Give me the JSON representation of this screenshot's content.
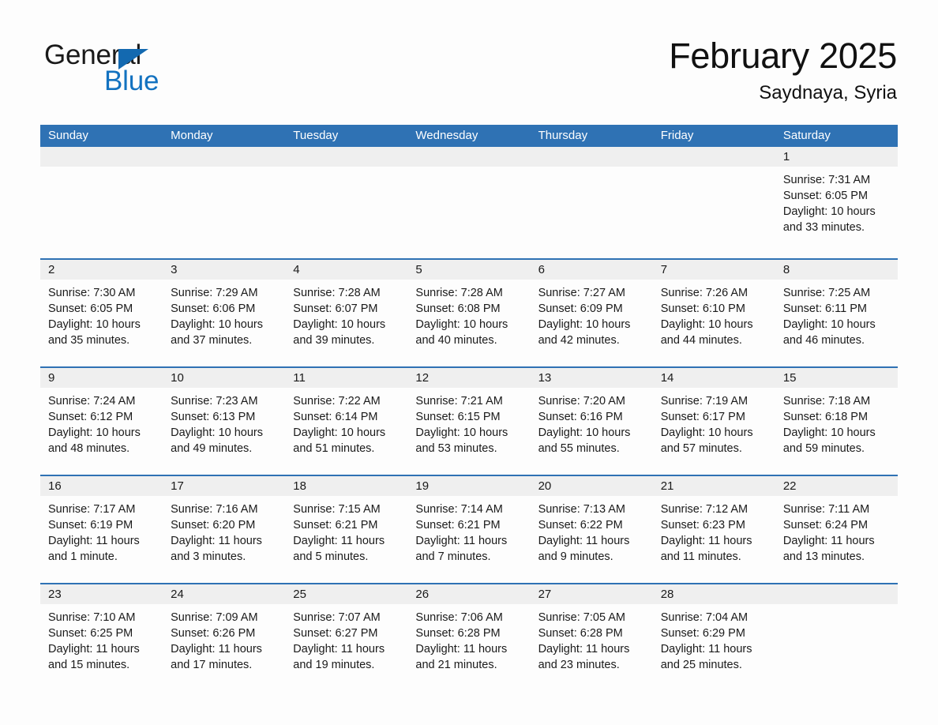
{
  "brand": {
    "name_part1": "General",
    "name_part2": "Blue",
    "logo_icon": "triangle-icon",
    "color_primary": "#1372c0",
    "color_dark": "#1a1a1a"
  },
  "header": {
    "title": "February 2025",
    "location": "Saydnaya, Syria"
  },
  "theme": {
    "header_blue": "#2f72b4",
    "date_band_gray": "#efefef",
    "page_background": "#fdfdfd",
    "text": "#1a1a1a"
  },
  "weekdays": [
    "Sunday",
    "Monday",
    "Tuesday",
    "Wednesday",
    "Thursday",
    "Friday",
    "Saturday"
  ],
  "weeks": [
    [
      {
        "date": "",
        "empty": true
      },
      {
        "date": "",
        "empty": true
      },
      {
        "date": "",
        "empty": true
      },
      {
        "date": "",
        "empty": true
      },
      {
        "date": "",
        "empty": true
      },
      {
        "date": "",
        "empty": true
      },
      {
        "date": "1",
        "sunrise": "Sunrise: 7:31 AM",
        "sunset": "Sunset: 6:05 PM",
        "daylight": "Daylight: 10 hours and 33 minutes."
      }
    ],
    [
      {
        "date": "2",
        "sunrise": "Sunrise: 7:30 AM",
        "sunset": "Sunset: 6:05 PM",
        "daylight": "Daylight: 10 hours and 35 minutes."
      },
      {
        "date": "3",
        "sunrise": "Sunrise: 7:29 AM",
        "sunset": "Sunset: 6:06 PM",
        "daylight": "Daylight: 10 hours and 37 minutes."
      },
      {
        "date": "4",
        "sunrise": "Sunrise: 7:28 AM",
        "sunset": "Sunset: 6:07 PM",
        "daylight": "Daylight: 10 hours and 39 minutes."
      },
      {
        "date": "5",
        "sunrise": "Sunrise: 7:28 AM",
        "sunset": "Sunset: 6:08 PM",
        "daylight": "Daylight: 10 hours and 40 minutes."
      },
      {
        "date": "6",
        "sunrise": "Sunrise: 7:27 AM",
        "sunset": "Sunset: 6:09 PM",
        "daylight": "Daylight: 10 hours and 42 minutes."
      },
      {
        "date": "7",
        "sunrise": "Sunrise: 7:26 AM",
        "sunset": "Sunset: 6:10 PM",
        "daylight": "Daylight: 10 hours and 44 minutes."
      },
      {
        "date": "8",
        "sunrise": "Sunrise: 7:25 AM",
        "sunset": "Sunset: 6:11 PM",
        "daylight": "Daylight: 10 hours and 46 minutes."
      }
    ],
    [
      {
        "date": "9",
        "sunrise": "Sunrise: 7:24 AM",
        "sunset": "Sunset: 6:12 PM",
        "daylight": "Daylight: 10 hours and 48 minutes."
      },
      {
        "date": "10",
        "sunrise": "Sunrise: 7:23 AM",
        "sunset": "Sunset: 6:13 PM",
        "daylight": "Daylight: 10 hours and 49 minutes."
      },
      {
        "date": "11",
        "sunrise": "Sunrise: 7:22 AM",
        "sunset": "Sunset: 6:14 PM",
        "daylight": "Daylight: 10 hours and 51 minutes."
      },
      {
        "date": "12",
        "sunrise": "Sunrise: 7:21 AM",
        "sunset": "Sunset: 6:15 PM",
        "daylight": "Daylight: 10 hours and 53 minutes."
      },
      {
        "date": "13",
        "sunrise": "Sunrise: 7:20 AM",
        "sunset": "Sunset: 6:16 PM",
        "daylight": "Daylight: 10 hours and 55 minutes."
      },
      {
        "date": "14",
        "sunrise": "Sunrise: 7:19 AM",
        "sunset": "Sunset: 6:17 PM",
        "daylight": "Daylight: 10 hours and 57 minutes."
      },
      {
        "date": "15",
        "sunrise": "Sunrise: 7:18 AM",
        "sunset": "Sunset: 6:18 PM",
        "daylight": "Daylight: 10 hours and 59 minutes."
      }
    ],
    [
      {
        "date": "16",
        "sunrise": "Sunrise: 7:17 AM",
        "sunset": "Sunset: 6:19 PM",
        "daylight": "Daylight: 11 hours and 1 minute."
      },
      {
        "date": "17",
        "sunrise": "Sunrise: 7:16 AM",
        "sunset": "Sunset: 6:20 PM",
        "daylight": "Daylight: 11 hours and 3 minutes."
      },
      {
        "date": "18",
        "sunrise": "Sunrise: 7:15 AM",
        "sunset": "Sunset: 6:21 PM",
        "daylight": "Daylight: 11 hours and 5 minutes."
      },
      {
        "date": "19",
        "sunrise": "Sunrise: 7:14 AM",
        "sunset": "Sunset: 6:21 PM",
        "daylight": "Daylight: 11 hours and 7 minutes."
      },
      {
        "date": "20",
        "sunrise": "Sunrise: 7:13 AM",
        "sunset": "Sunset: 6:22 PM",
        "daylight": "Daylight: 11 hours and 9 minutes."
      },
      {
        "date": "21",
        "sunrise": "Sunrise: 7:12 AM",
        "sunset": "Sunset: 6:23 PM",
        "daylight": "Daylight: 11 hours and 11 minutes."
      },
      {
        "date": "22",
        "sunrise": "Sunrise: 7:11 AM",
        "sunset": "Sunset: 6:24 PM",
        "daylight": "Daylight: 11 hours and 13 minutes."
      }
    ],
    [
      {
        "date": "23",
        "sunrise": "Sunrise: 7:10 AM",
        "sunset": "Sunset: 6:25 PM",
        "daylight": "Daylight: 11 hours and 15 minutes."
      },
      {
        "date": "24",
        "sunrise": "Sunrise: 7:09 AM",
        "sunset": "Sunset: 6:26 PM",
        "daylight": "Daylight: 11 hours and 17 minutes."
      },
      {
        "date": "25",
        "sunrise": "Sunrise: 7:07 AM",
        "sunset": "Sunset: 6:27 PM",
        "daylight": "Daylight: 11 hours and 19 minutes."
      },
      {
        "date": "26",
        "sunrise": "Sunrise: 7:06 AM",
        "sunset": "Sunset: 6:28 PM",
        "daylight": "Daylight: 11 hours and 21 minutes."
      },
      {
        "date": "27",
        "sunrise": "Sunrise: 7:05 AM",
        "sunset": "Sunset: 6:28 PM",
        "daylight": "Daylight: 11 hours and 23 minutes."
      },
      {
        "date": "28",
        "sunrise": "Sunrise: 7:04 AM",
        "sunset": "Sunset: 6:29 PM",
        "daylight": "Daylight: 11 hours and 25 minutes."
      },
      {
        "date": "",
        "empty": true
      }
    ]
  ]
}
